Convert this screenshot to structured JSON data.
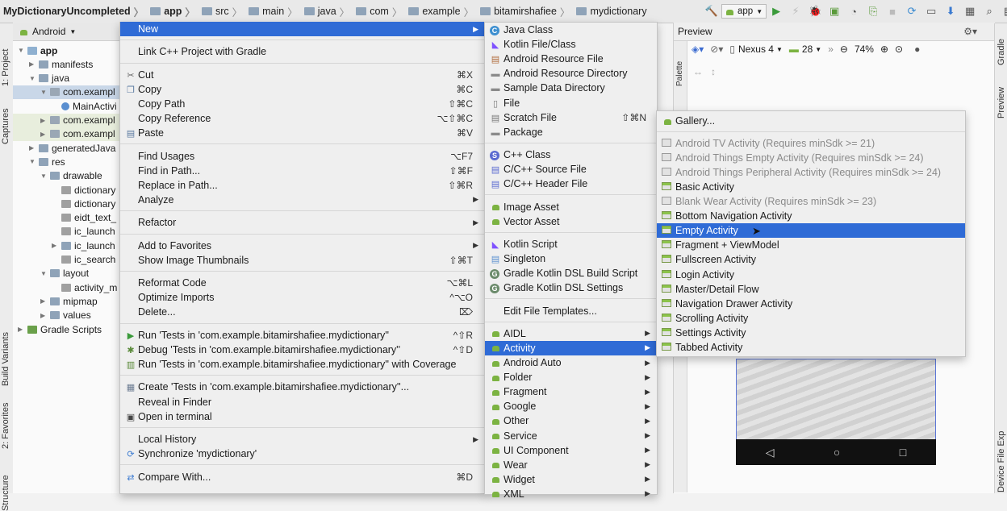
{
  "breadcrumb": [
    "MyDictionaryUncompleted",
    "app",
    "src",
    "main",
    "java",
    "com",
    "example",
    "bitamirshafiee",
    "mydictionary"
  ],
  "toolbar": {
    "run_config": "app"
  },
  "left_strip": {
    "project": "1: Project",
    "captures": "Captures",
    "build_variants": "Build Variants",
    "favorites": "2: Favorites",
    "structure": "Structure"
  },
  "right_strip": {
    "gradle": "Gradle",
    "preview": "Preview",
    "device_file": "Device File Exp"
  },
  "project": {
    "view_mode": "Android",
    "tree": [
      {
        "label": "app",
        "level": 0,
        "expanded": true,
        "type": "module",
        "bold": true
      },
      {
        "label": "manifests",
        "level": 1,
        "expanded": false,
        "type": "folder"
      },
      {
        "label": "java",
        "level": 1,
        "expanded": true,
        "type": "folder"
      },
      {
        "label": "com.exampl",
        "level": 2,
        "expanded": true,
        "type": "package",
        "selected": true
      },
      {
        "label": "MainActivi",
        "level": 3,
        "type": "class"
      },
      {
        "label": "com.exampl",
        "level": 2,
        "expanded": false,
        "type": "package",
        "highlight": true
      },
      {
        "label": "com.exampl",
        "level": 2,
        "expanded": false,
        "type": "package",
        "highlight": true
      },
      {
        "label": "generatedJava",
        "level": 1,
        "expanded": false,
        "type": "folder"
      },
      {
        "label": "res",
        "level": 1,
        "expanded": true,
        "type": "folder"
      },
      {
        "label": "drawable",
        "level": 2,
        "expanded": true,
        "type": "folder"
      },
      {
        "label": "dictionary",
        "level": 3,
        "type": "file"
      },
      {
        "label": "dictionary",
        "level": 3,
        "type": "file"
      },
      {
        "label": "eidt_text_",
        "level": 3,
        "type": "file"
      },
      {
        "label": "ic_launch",
        "level": 3,
        "type": "file"
      },
      {
        "label": "ic_launch",
        "level": 3,
        "expanded": false,
        "type": "folder"
      },
      {
        "label": "ic_search",
        "level": 3,
        "type": "file"
      },
      {
        "label": "layout",
        "level": 2,
        "expanded": true,
        "type": "folder"
      },
      {
        "label": "activity_m",
        "level": 3,
        "type": "file"
      },
      {
        "label": "mipmap",
        "level": 2,
        "expanded": false,
        "type": "folder"
      },
      {
        "label": "values",
        "level": 2,
        "expanded": false,
        "type": "folder"
      },
      {
        "label": "Gradle Scripts",
        "level": 0,
        "expanded": false,
        "type": "gradle"
      }
    ]
  },
  "context_menu": {
    "items": [
      {
        "label": "New",
        "submenu": true,
        "active": true
      },
      {
        "sep": true
      },
      {
        "label": "Link C++ Project with Gradle"
      },
      {
        "sep": true
      },
      {
        "label": "Cut",
        "shortcut": "⌘X",
        "icon": "cut-icon"
      },
      {
        "label": "Copy",
        "shortcut": "⌘C",
        "icon": "copy-icon"
      },
      {
        "label": "Copy Path",
        "shortcut": "⇧⌘C"
      },
      {
        "label": "Copy Reference",
        "shortcut": "⌥⇧⌘C"
      },
      {
        "label": "Paste",
        "shortcut": "⌘V",
        "icon": "paste-icon"
      },
      {
        "sep": true
      },
      {
        "label": "Find Usages",
        "shortcut": "⌥F7"
      },
      {
        "label": "Find in Path...",
        "shortcut": "⇧⌘F"
      },
      {
        "label": "Replace in Path...",
        "shortcut": "⇧⌘R"
      },
      {
        "label": "Analyze",
        "submenu": true
      },
      {
        "sep": true
      },
      {
        "label": "Refactor",
        "submenu": true
      },
      {
        "sep": true
      },
      {
        "label": "Add to Favorites",
        "submenu": true
      },
      {
        "label": "Show Image Thumbnails",
        "shortcut": "⇧⌘T"
      },
      {
        "sep": true
      },
      {
        "label": "Reformat Code",
        "shortcut": "⌥⌘L"
      },
      {
        "label": "Optimize Imports",
        "shortcut": "^⌥O"
      },
      {
        "label": "Delete...",
        "shortcut": "⌦"
      },
      {
        "sep": true
      },
      {
        "label": "Run 'Tests in 'com.example.bitamirshafiee.mydictionary''",
        "shortcut": "^⇧R",
        "icon": "run-icon"
      },
      {
        "label": "Debug 'Tests in 'com.example.bitamirshafiee.mydictionary''",
        "shortcut": "^⇧D",
        "icon": "debug-icon"
      },
      {
        "label": "Run 'Tests in 'com.example.bitamirshafiee.mydictionary'' with Coverage",
        "icon": "coverage-icon"
      },
      {
        "sep": true
      },
      {
        "label": "Create 'Tests in 'com.example.bitamirshafiee.mydictionary''...",
        "icon": "create-test-icon"
      },
      {
        "label": "Reveal in Finder"
      },
      {
        "label": "Open in terminal",
        "icon": "terminal-icon"
      },
      {
        "sep": true
      },
      {
        "label": "Local History",
        "submenu": true
      },
      {
        "label": "Synchronize 'mydictionary'",
        "icon": "sync-icon"
      },
      {
        "sep": true
      },
      {
        "label": "Compare With...",
        "shortcut": "⌘D",
        "icon": "compare-icon"
      }
    ]
  },
  "new_menu": {
    "items": [
      {
        "label": "Java Class",
        "icon": "java-class-icon"
      },
      {
        "label": "Kotlin File/Class",
        "icon": "kotlin-icon"
      },
      {
        "label": "Android Resource File",
        "icon": "resource-file-icon"
      },
      {
        "label": "Android Resource Directory",
        "icon": "folder-icon"
      },
      {
        "label": "Sample Data Directory",
        "icon": "folder-icon"
      },
      {
        "label": "File",
        "icon": "file-icon"
      },
      {
        "label": "Scratch File",
        "shortcut": "⇧⌘N",
        "icon": "scratch-icon"
      },
      {
        "label": "Package",
        "icon": "package-icon"
      },
      {
        "sep": true
      },
      {
        "label": "C++ Class",
        "icon": "cpp-class-icon"
      },
      {
        "label": "C/C++ Source File",
        "icon": "cpp-source-icon"
      },
      {
        "label": "C/C++ Header File",
        "icon": "cpp-header-icon"
      },
      {
        "sep": true
      },
      {
        "label": "Image Asset",
        "icon": "android-icon"
      },
      {
        "label": "Vector Asset",
        "icon": "android-icon"
      },
      {
        "sep": true
      },
      {
        "label": "Kotlin Script",
        "icon": "kotlin-icon"
      },
      {
        "label": "Singleton",
        "icon": "singleton-icon"
      },
      {
        "label": "Gradle Kotlin DSL Build Script",
        "icon": "gradle-icon"
      },
      {
        "label": "Gradle Kotlin DSL Settings",
        "icon": "gradle-icon"
      },
      {
        "sep": true
      },
      {
        "label": "Edit File Templates..."
      },
      {
        "sep": true
      },
      {
        "label": "AIDL",
        "submenu": true,
        "icon": "android-icon"
      },
      {
        "label": "Activity",
        "submenu": true,
        "active": true,
        "icon": "android-icon"
      },
      {
        "label": "Android Auto",
        "submenu": true,
        "icon": "android-icon"
      },
      {
        "label": "Folder",
        "submenu": true,
        "icon": "android-icon"
      },
      {
        "label": "Fragment",
        "submenu": true,
        "icon": "android-icon"
      },
      {
        "label": "Google",
        "submenu": true,
        "icon": "android-icon"
      },
      {
        "label": "Other",
        "submenu": true,
        "icon": "android-icon"
      },
      {
        "label": "Service",
        "submenu": true,
        "icon": "android-icon"
      },
      {
        "label": "UI Component",
        "submenu": true,
        "icon": "android-icon"
      },
      {
        "label": "Wear",
        "submenu": true,
        "icon": "android-icon"
      },
      {
        "label": "Widget",
        "submenu": true,
        "icon": "android-icon"
      },
      {
        "label": "XML",
        "submenu": true,
        "icon": "android-icon"
      }
    ]
  },
  "activity_menu": {
    "items": [
      {
        "label": "Gallery...",
        "icon": "android-icon"
      },
      {
        "sep": true
      },
      {
        "label": "Android TV Activity (Requires minSdk >= 21)",
        "disabled": true
      },
      {
        "label": "Android Things Empty Activity (Requires minSdk >= 24)",
        "disabled": true
      },
      {
        "label": "Android Things Peripheral Activity (Requires minSdk >= 24)",
        "disabled": true
      },
      {
        "label": "Basic Activity"
      },
      {
        "label": "Blank Wear Activity (Requires minSdk >= 23)",
        "disabled": true
      },
      {
        "label": "Bottom Navigation Activity"
      },
      {
        "label": "Empty Activity",
        "active": true
      },
      {
        "label": "Fragment + ViewModel"
      },
      {
        "label": "Fullscreen Activity"
      },
      {
        "label": "Login Activity"
      },
      {
        "label": "Master/Detail Flow"
      },
      {
        "label": "Navigation Drawer Activity"
      },
      {
        "label": "Scrolling Activity"
      },
      {
        "label": "Settings Activity"
      },
      {
        "label": "Tabbed Activity"
      }
    ]
  },
  "preview": {
    "title": "Preview",
    "palette": "Palette",
    "device": "Nexus 4",
    "api": "28",
    "zoom": "74%"
  },
  "colors": {
    "selection": "#2f6bd6",
    "android_green": "#7cb342"
  }
}
